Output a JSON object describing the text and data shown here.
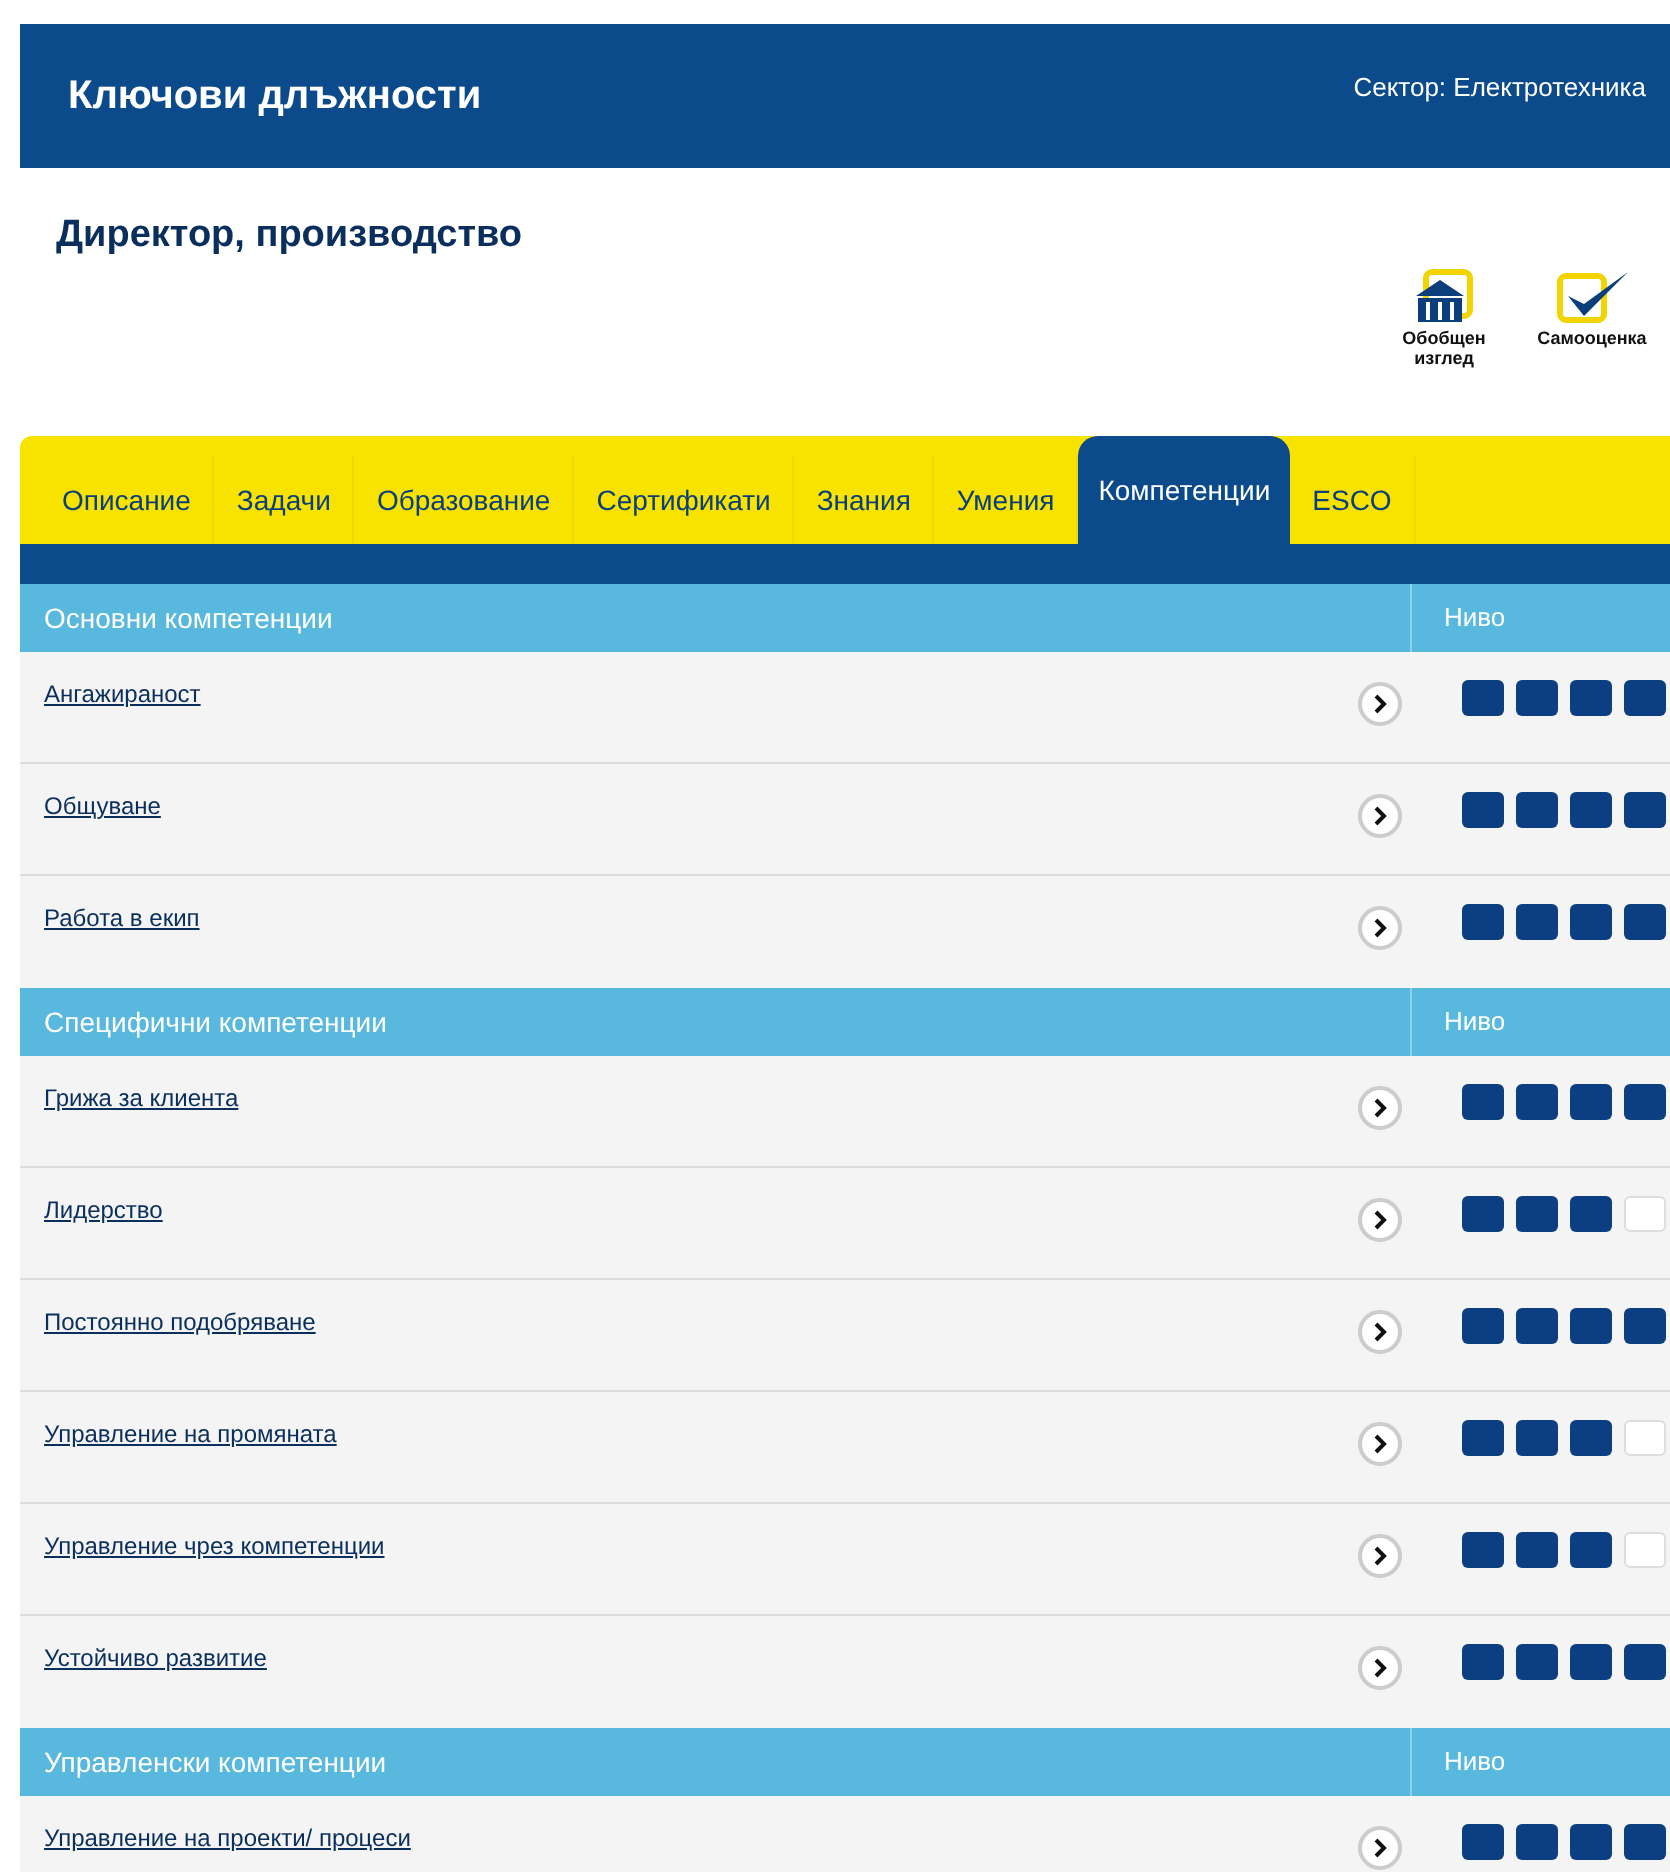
{
  "header": {
    "title": "Ключови длъжности",
    "sector": "Сектор: Електротехника"
  },
  "job_title": "Директор, производство",
  "actions": [
    {
      "kind": "overview",
      "label": "Обобщен изглед"
    },
    {
      "kind": "self_assessment",
      "label": "Самооценка"
    }
  ],
  "tabs": [
    {
      "label": "Описание",
      "selected": false
    },
    {
      "label": "Задачи",
      "selected": false
    },
    {
      "label": "Образование",
      "selected": false
    },
    {
      "label": "Сертификати",
      "selected": false
    },
    {
      "label": "Знания",
      "selected": false
    },
    {
      "label": "Умения",
      "selected": false
    },
    {
      "label": "Компетенции",
      "selected": true
    },
    {
      "label": "ESCO",
      "selected": false
    }
  ],
  "sections": [
    {
      "title": "Основни компетенции",
      "level_heading": "Ниво",
      "items": [
        {
          "name": "Ангажираност",
          "stars": 4
        },
        {
          "name": "Общуване",
          "stars": 4
        },
        {
          "name": "Работа в екип",
          "stars": 4
        }
      ]
    },
    {
      "title": "Специфични компетенции",
      "level_heading": "Ниво",
      "items": [
        {
          "name": "Грижа за клиента",
          "stars": 4
        },
        {
          "name": "Лидерство",
          "stars": 3
        },
        {
          "name": "Постоянно подобряване",
          "stars": 4
        },
        {
          "name": "Управление на промяната",
          "stars": 3
        },
        {
          "name": "Управление чрез компетенции",
          "stars": 3
        },
        {
          "name": "Устойчиво развитие",
          "stars": 4
        }
      ]
    },
    {
      "title": "Управленски компетенции",
      "level_heading": "Ниво",
      "items": [
        {
          "name": "Управление на проекти/ процеси",
          "stars": 4
        }
      ]
    }
  ]
}
